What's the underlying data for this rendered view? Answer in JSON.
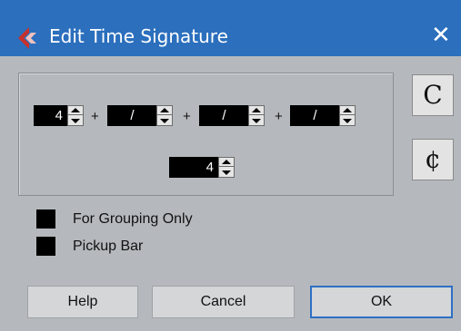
{
  "window": {
    "title": "Edit Time Signature",
    "close_glyph": "✕",
    "app_icon": "cubase-logo-icon"
  },
  "numerators": [
    {
      "value": "4"
    },
    {
      "value": "/"
    },
    {
      "value": "/"
    },
    {
      "value": "/"
    }
  ],
  "plus_signs": [
    "+",
    "+",
    "+"
  ],
  "denominator": {
    "value": "4"
  },
  "side_buttons": {
    "common_time": "C",
    "cut_time": "¢"
  },
  "checkboxes": [
    {
      "label": "For Grouping Only",
      "checked": false
    },
    {
      "label": "Pickup Bar",
      "checked": false
    }
  ],
  "buttons": {
    "help": "Help",
    "cancel": "Cancel",
    "ok": "OK"
  },
  "colors": {
    "titlebar": "#2b6fbd",
    "background": "#b5b9bd",
    "field_bg": "#000000",
    "default_border": "#2f6fc4",
    "icon_red": "#c8312c"
  }
}
